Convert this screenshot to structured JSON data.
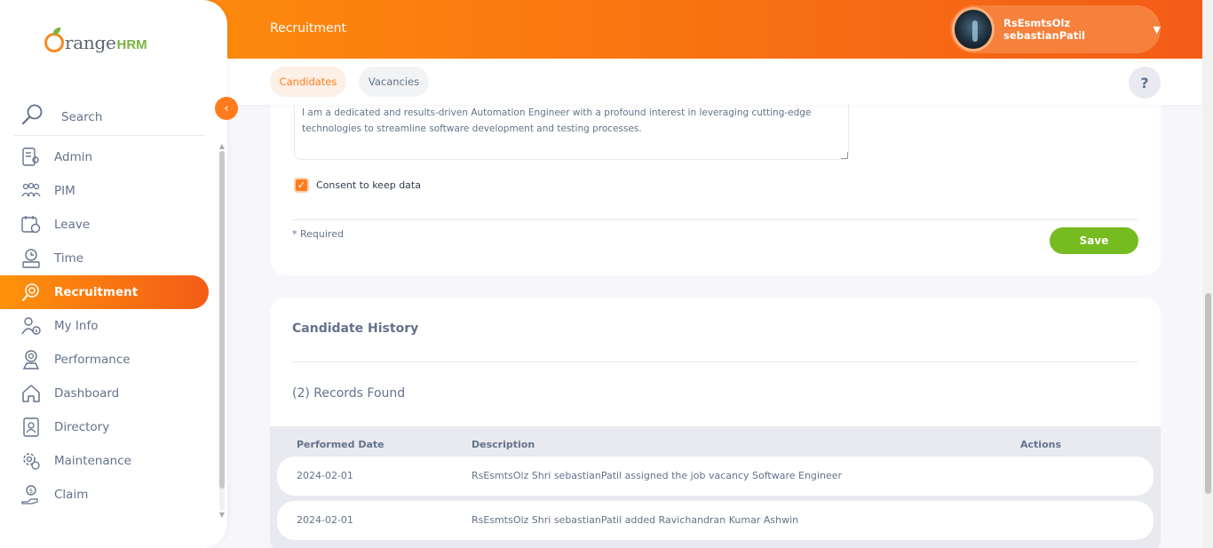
{
  "brand": {
    "name_part1": "range",
    "name_part2": "HRM"
  },
  "sidebar": {
    "search_label": "Search",
    "items": [
      {
        "label": "Admin",
        "icon": "admin-icon"
      },
      {
        "label": "PIM",
        "icon": "pim-icon"
      },
      {
        "label": "Leave",
        "icon": "leave-icon"
      },
      {
        "label": "Time",
        "icon": "time-icon"
      },
      {
        "label": "Recruitment",
        "icon": "recruitment-icon",
        "active": true
      },
      {
        "label": "My Info",
        "icon": "my-info-icon"
      },
      {
        "label": "Performance",
        "icon": "performance-icon"
      },
      {
        "label": "Dashboard",
        "icon": "dashboard-icon"
      },
      {
        "label": "Directory",
        "icon": "directory-icon"
      },
      {
        "label": "Maintenance",
        "icon": "maintenance-icon"
      },
      {
        "label": "Claim",
        "icon": "claim-icon"
      }
    ]
  },
  "topbar": {
    "title": "Recruitment",
    "user_name": "RsEsmtsOlz sebastianPatil"
  },
  "subnav": {
    "tabs": [
      {
        "label": "Candidates",
        "active": true
      },
      {
        "label": "Vacancies"
      }
    ],
    "help_label": "?"
  },
  "form": {
    "notes_value": "I am a dedicated and results-driven Automation Engineer with a profound interest in leveraging cutting-edge technologies to streamline software development and testing processes.",
    "consent_label": "Consent to keep data",
    "consent_checked": true,
    "required_label": "* Required",
    "save_label": "Save"
  },
  "history": {
    "heading": "Candidate History",
    "records_label": "(2) Records Found",
    "columns": [
      "Performed Date",
      "Description",
      "Actions"
    ],
    "rows": [
      {
        "date": "2024-02-01",
        "description": "RsEsmtsOlz Shri sebastianPatil assigned the job vacancy Software Engineer"
      },
      {
        "date": "2024-02-01",
        "description": "RsEsmtsOlz Shri sebastianPatil added Ravichandran Kumar Ashwin"
      }
    ]
  },
  "colors": {
    "accent": "#ff7b1d",
    "save": "#76bc21",
    "text": "#64728c"
  }
}
